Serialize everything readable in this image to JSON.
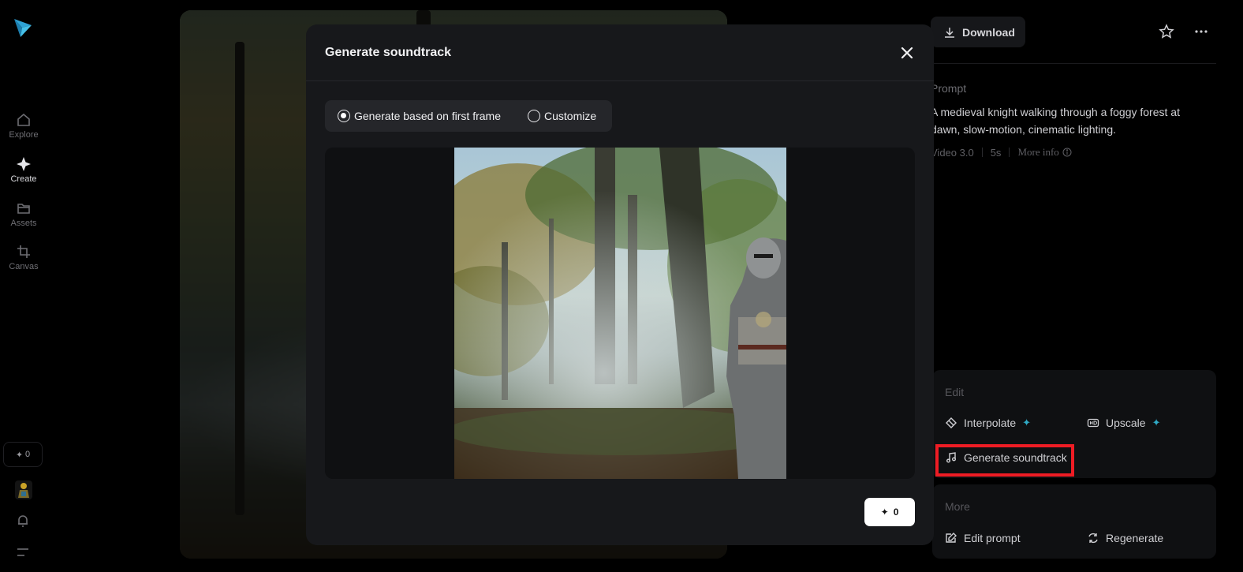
{
  "sidebar": {
    "items": [
      {
        "label": "Explore",
        "icon": "home-icon"
      },
      {
        "label": "Create",
        "icon": "sparkle-icon"
      },
      {
        "label": "Assets",
        "icon": "folder-icon"
      },
      {
        "label": "Canvas",
        "icon": "crop-icon"
      }
    ],
    "credits": "0"
  },
  "header": {
    "download_label": "Download"
  },
  "details": {
    "prompt_label": "Prompt",
    "prompt_text": "A medieval knight walking through a foggy forest at dawn, slow-motion, cinematic lighting.",
    "model": "Video 3.0",
    "duration": "5s",
    "more_info": "More info"
  },
  "edit_card": {
    "title": "Edit",
    "interpolate": "Interpolate",
    "upscale": "Upscale",
    "generate_soundtrack": "Generate soundtrack"
  },
  "more_card": {
    "title": "More",
    "edit_prompt": "Edit prompt",
    "regenerate": "Regenerate"
  },
  "modal": {
    "title": "Generate soundtrack",
    "options": [
      "Generate based on first frame",
      "Customize"
    ],
    "selected_option": "Generate based on first frame",
    "generate_cost": "0"
  },
  "colors": {
    "accent": "#2fa9c4",
    "highlight": "#ee1c24",
    "modal_bg": "#17181b"
  }
}
